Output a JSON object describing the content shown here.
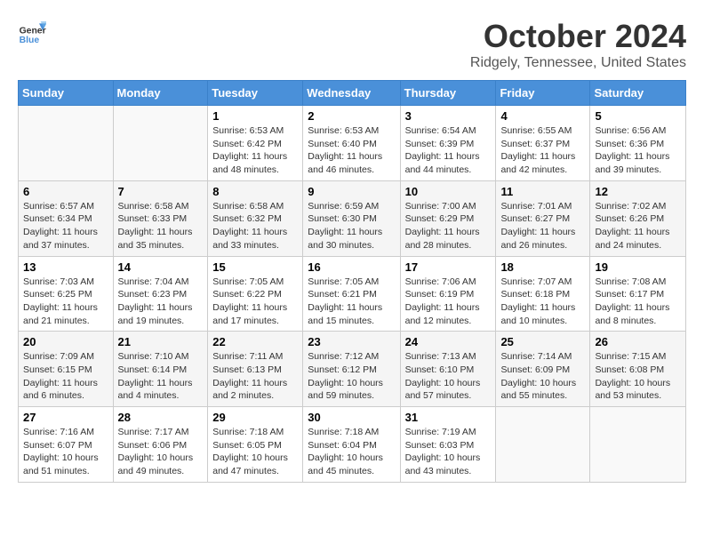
{
  "logo": {
    "text_general": "General",
    "text_blue": "Blue"
  },
  "header": {
    "month": "October 2024",
    "location": "Ridgely, Tennessee, United States"
  },
  "weekdays": [
    "Sunday",
    "Monday",
    "Tuesday",
    "Wednesday",
    "Thursday",
    "Friday",
    "Saturday"
  ],
  "weeks": [
    [
      {
        "day": "",
        "info": ""
      },
      {
        "day": "",
        "info": ""
      },
      {
        "day": "1",
        "info": "Sunrise: 6:53 AM\nSunset: 6:42 PM\nDaylight: 11 hours and 48 minutes."
      },
      {
        "day": "2",
        "info": "Sunrise: 6:53 AM\nSunset: 6:40 PM\nDaylight: 11 hours and 46 minutes."
      },
      {
        "day": "3",
        "info": "Sunrise: 6:54 AM\nSunset: 6:39 PM\nDaylight: 11 hours and 44 minutes."
      },
      {
        "day": "4",
        "info": "Sunrise: 6:55 AM\nSunset: 6:37 PM\nDaylight: 11 hours and 42 minutes."
      },
      {
        "day": "5",
        "info": "Sunrise: 6:56 AM\nSunset: 6:36 PM\nDaylight: 11 hours and 39 minutes."
      }
    ],
    [
      {
        "day": "6",
        "info": "Sunrise: 6:57 AM\nSunset: 6:34 PM\nDaylight: 11 hours and 37 minutes."
      },
      {
        "day": "7",
        "info": "Sunrise: 6:58 AM\nSunset: 6:33 PM\nDaylight: 11 hours and 35 minutes."
      },
      {
        "day": "8",
        "info": "Sunrise: 6:58 AM\nSunset: 6:32 PM\nDaylight: 11 hours and 33 minutes."
      },
      {
        "day": "9",
        "info": "Sunrise: 6:59 AM\nSunset: 6:30 PM\nDaylight: 11 hours and 30 minutes."
      },
      {
        "day": "10",
        "info": "Sunrise: 7:00 AM\nSunset: 6:29 PM\nDaylight: 11 hours and 28 minutes."
      },
      {
        "day": "11",
        "info": "Sunrise: 7:01 AM\nSunset: 6:27 PM\nDaylight: 11 hours and 26 minutes."
      },
      {
        "day": "12",
        "info": "Sunrise: 7:02 AM\nSunset: 6:26 PM\nDaylight: 11 hours and 24 minutes."
      }
    ],
    [
      {
        "day": "13",
        "info": "Sunrise: 7:03 AM\nSunset: 6:25 PM\nDaylight: 11 hours and 21 minutes."
      },
      {
        "day": "14",
        "info": "Sunrise: 7:04 AM\nSunset: 6:23 PM\nDaylight: 11 hours and 19 minutes."
      },
      {
        "day": "15",
        "info": "Sunrise: 7:05 AM\nSunset: 6:22 PM\nDaylight: 11 hours and 17 minutes."
      },
      {
        "day": "16",
        "info": "Sunrise: 7:05 AM\nSunset: 6:21 PM\nDaylight: 11 hours and 15 minutes."
      },
      {
        "day": "17",
        "info": "Sunrise: 7:06 AM\nSunset: 6:19 PM\nDaylight: 11 hours and 12 minutes."
      },
      {
        "day": "18",
        "info": "Sunrise: 7:07 AM\nSunset: 6:18 PM\nDaylight: 11 hours and 10 minutes."
      },
      {
        "day": "19",
        "info": "Sunrise: 7:08 AM\nSunset: 6:17 PM\nDaylight: 11 hours and 8 minutes."
      }
    ],
    [
      {
        "day": "20",
        "info": "Sunrise: 7:09 AM\nSunset: 6:15 PM\nDaylight: 11 hours and 6 minutes."
      },
      {
        "day": "21",
        "info": "Sunrise: 7:10 AM\nSunset: 6:14 PM\nDaylight: 11 hours and 4 minutes."
      },
      {
        "day": "22",
        "info": "Sunrise: 7:11 AM\nSunset: 6:13 PM\nDaylight: 11 hours and 2 minutes."
      },
      {
        "day": "23",
        "info": "Sunrise: 7:12 AM\nSunset: 6:12 PM\nDaylight: 10 hours and 59 minutes."
      },
      {
        "day": "24",
        "info": "Sunrise: 7:13 AM\nSunset: 6:10 PM\nDaylight: 10 hours and 57 minutes."
      },
      {
        "day": "25",
        "info": "Sunrise: 7:14 AM\nSunset: 6:09 PM\nDaylight: 10 hours and 55 minutes."
      },
      {
        "day": "26",
        "info": "Sunrise: 7:15 AM\nSunset: 6:08 PM\nDaylight: 10 hours and 53 minutes."
      }
    ],
    [
      {
        "day": "27",
        "info": "Sunrise: 7:16 AM\nSunset: 6:07 PM\nDaylight: 10 hours and 51 minutes."
      },
      {
        "day": "28",
        "info": "Sunrise: 7:17 AM\nSunset: 6:06 PM\nDaylight: 10 hours and 49 minutes."
      },
      {
        "day": "29",
        "info": "Sunrise: 7:18 AM\nSunset: 6:05 PM\nDaylight: 10 hours and 47 minutes."
      },
      {
        "day": "30",
        "info": "Sunrise: 7:18 AM\nSunset: 6:04 PM\nDaylight: 10 hours and 45 minutes."
      },
      {
        "day": "31",
        "info": "Sunrise: 7:19 AM\nSunset: 6:03 PM\nDaylight: 10 hours and 43 minutes."
      },
      {
        "day": "",
        "info": ""
      },
      {
        "day": "",
        "info": ""
      }
    ]
  ]
}
